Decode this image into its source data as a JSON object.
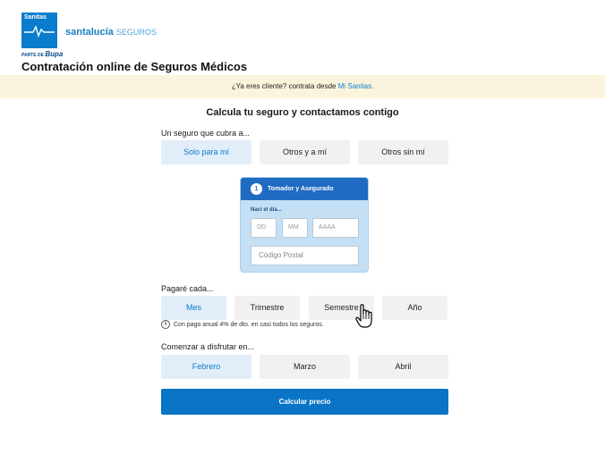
{
  "header": {
    "logo_sanitas": "Sanitas",
    "logo_partner_prefix": "PARTE DE",
    "logo_partner_brand": "Bupa",
    "logo_santalucia": "santalucía",
    "logo_seguros": "SEGUROS",
    "page_title": "Contratación online de Seguros Médicos"
  },
  "banner": {
    "text": "¿Ya eres cliente? contrata desde ",
    "link": "Mi Sanitas",
    "suffix": "."
  },
  "form": {
    "title": "Calcula tu seguro y contactamos contigo",
    "coverage": {
      "label": "Un seguro que cubra a...",
      "options": [
        "Solo para mí",
        "Otros y a mí",
        "Otros sin mí"
      ],
      "selected": "Solo para mí"
    },
    "card": {
      "step": "1",
      "title": "Tomador y Asegurado",
      "birth_label": "Nací el día...",
      "dd_placeholder": "DD",
      "mm_placeholder": "MM",
      "yyyy_placeholder": "AAAA",
      "postal_placeholder": "Código Postal"
    },
    "payment": {
      "label": "Pagaré cada...",
      "options": [
        "Mes",
        "Trimestre",
        "Semestre",
        "Año"
      ],
      "selected": "Mes",
      "info": "Con pago anual 4% de dto. en casi todos los seguros."
    },
    "start": {
      "label": "Comenzar a disfrutar en...",
      "options": [
        "Febrero",
        "Marzo",
        "Abril"
      ],
      "selected": "Febrero"
    },
    "calculate_label": "Calcular precio"
  },
  "colors": {
    "brand": "#0a7ccd",
    "banner_bg": "#fbf4dc",
    "selected_bg": "#e1eef9",
    "card_header": "#1f6bc1"
  }
}
